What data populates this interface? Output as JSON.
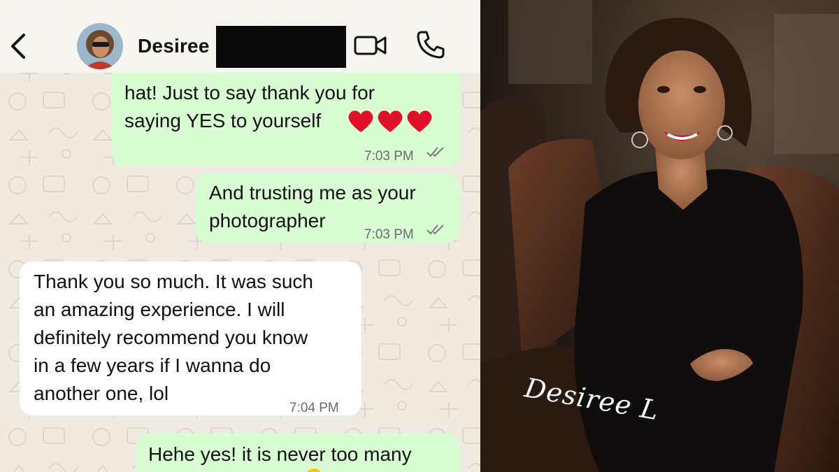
{
  "header": {
    "back_icon": "chevron-left-icon",
    "contact_name": "Desiree",
    "video_icon": "video-camera-icon",
    "call_icon": "phone-icon"
  },
  "messages": [
    {
      "direction": "outgoing",
      "lines": [
        "hat! Just to say thank you for",
        "saying YES to yourself"
      ],
      "emoji": "heart-icon x3",
      "time": "7:03 PM",
      "status": "read"
    },
    {
      "direction": "outgoing",
      "lines": [
        "And trusting me as your",
        "photographer"
      ],
      "time": "7:03 PM",
      "status": "read"
    },
    {
      "direction": "incoming",
      "lines": [
        "Thank you so much. It was such",
        "an amazing experience. I will",
        "definitely recommend you know",
        "in a few years if I wanna do",
        "another one, lol"
      ],
      "time": "7:04 PM"
    },
    {
      "direction": "outgoing",
      "lines": [
        "Hehe yes! it is never too many"
      ]
    }
  ],
  "photo": {
    "signature": "Desiree L"
  },
  "colors": {
    "outgoing_bubble": "#d9fdd3",
    "incoming_bubble": "#ffffff",
    "chat_background": "#efeae2",
    "heart": "#e0102a"
  }
}
